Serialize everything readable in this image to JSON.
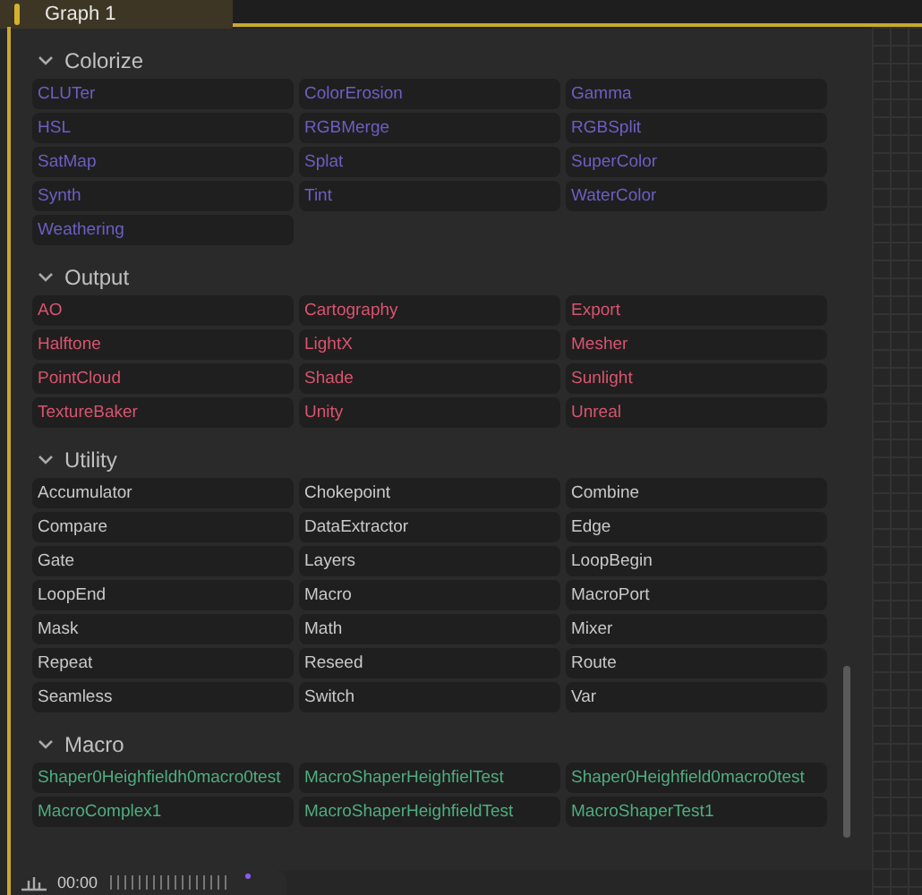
{
  "tab": {
    "label": "Graph 1",
    "selected": true
  },
  "sections": [
    {
      "title": "Colorize",
      "expanded": true,
      "color": "#6c5fc4",
      "items": [
        "CLUTer",
        "ColorErosion",
        "Gamma",
        "HSL",
        "RGBMerge",
        "RGBSplit",
        "SatMap",
        "Splat",
        "SuperColor",
        "Synth",
        "Tint",
        "WaterColor",
        "Weathering"
      ]
    },
    {
      "title": "Output",
      "expanded": true,
      "color": "#d9546f",
      "items": [
        "AO",
        "Cartography",
        "Export",
        "Halftone",
        "LightX",
        "Mesher",
        "PointCloud",
        "Shade",
        "Sunlight",
        "TextureBaker",
        "Unity",
        "Unreal"
      ]
    },
    {
      "title": "Utility",
      "expanded": true,
      "color": "#c9c9c9",
      "items": [
        "Accumulator",
        "Chokepoint",
        "Combine",
        "Compare",
        "DataExtractor",
        "Edge",
        "Gate",
        "Layers",
        "LoopBegin",
        "LoopEnd",
        "Macro",
        "MacroPort",
        "Mask",
        "Math",
        "Mixer",
        "Repeat",
        "Reseed",
        "Route",
        "Seamless",
        "Switch",
        "Var"
      ]
    },
    {
      "title": "Macro",
      "expanded": true,
      "color": "#4fae80",
      "items": [
        "Shaper0Heighfieldh0macro0test",
        "MacroShaperHeighfielTest",
        "Shaper0Heighfield0macro0test",
        "MacroComplex1",
        "MacroShaperHeighfieldTest",
        "MacroShaperTest1"
      ]
    }
  ],
  "timeline": {
    "time": "00:00"
  }
}
